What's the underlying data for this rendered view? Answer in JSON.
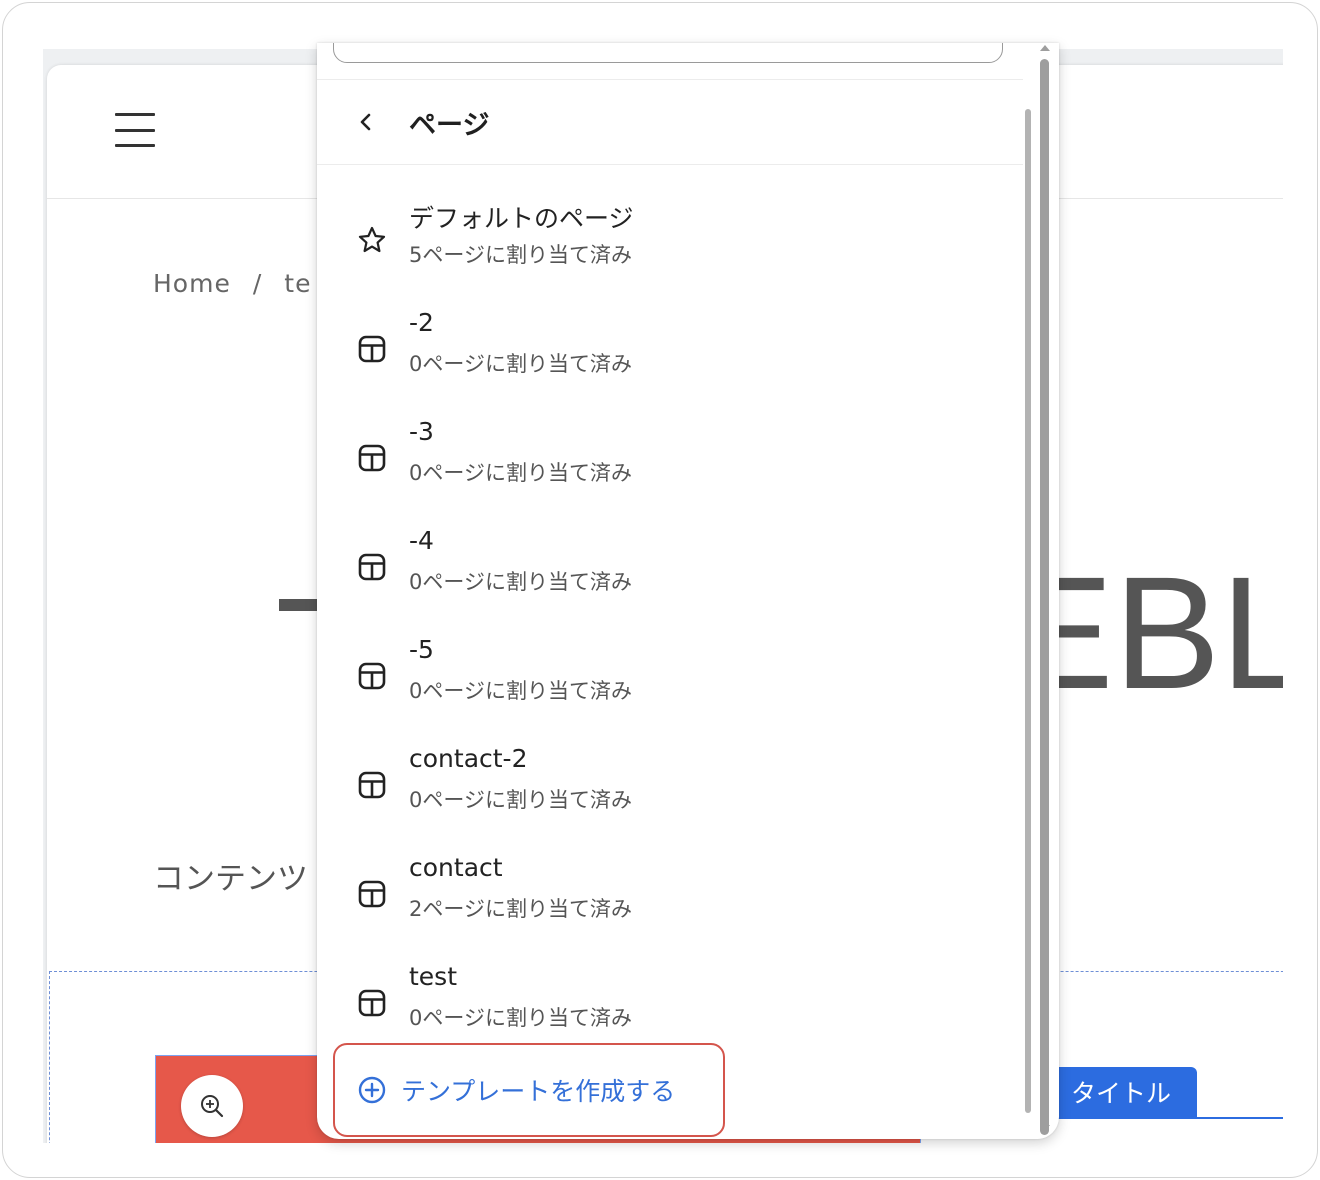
{
  "page": {
    "hamburger_icon": "menu-icon",
    "breadcrumb": {
      "home": "Home",
      "separator": "/",
      "current": "te"
    },
    "hero_title_fragment": "EBL",
    "contents_label": "コンテンツ",
    "zoom_icon": "zoom-in-icon",
    "title_tab": "タイトル"
  },
  "popover": {
    "back_icon": "chevron-left-icon",
    "title": "ページ",
    "templates": [
      {
        "name": "デフォルトのページ",
        "assigned": "5ページに割り当て済み",
        "icon": "star-icon"
      },
      {
        "name": "-2",
        "assigned": "0ページに割り当て済み",
        "icon": "layout-icon"
      },
      {
        "name": "-3",
        "assigned": "0ページに割り当て済み",
        "icon": "layout-icon"
      },
      {
        "name": "-4",
        "assigned": "0ページに割り当て済み",
        "icon": "layout-icon"
      },
      {
        "name": "-5",
        "assigned": "0ページに割り当て済み",
        "icon": "layout-icon"
      },
      {
        "name": "contact-2",
        "assigned": "0ページに割り当て済み",
        "icon": "layout-icon"
      },
      {
        "name": "contact",
        "assigned": "2ページに割り当て済み",
        "icon": "layout-icon"
      },
      {
        "name": "test",
        "assigned": "0ページに割り当て済み",
        "icon": "layout-icon"
      }
    ],
    "create_button": {
      "label": "テンプレートを作成する",
      "icon": "plus-circle-icon"
    }
  },
  "colors": {
    "accent_blue": "#3470d8",
    "highlight_red": "#d4554c",
    "block_red": "#e6584a",
    "tab_blue": "#2c6ce0"
  }
}
